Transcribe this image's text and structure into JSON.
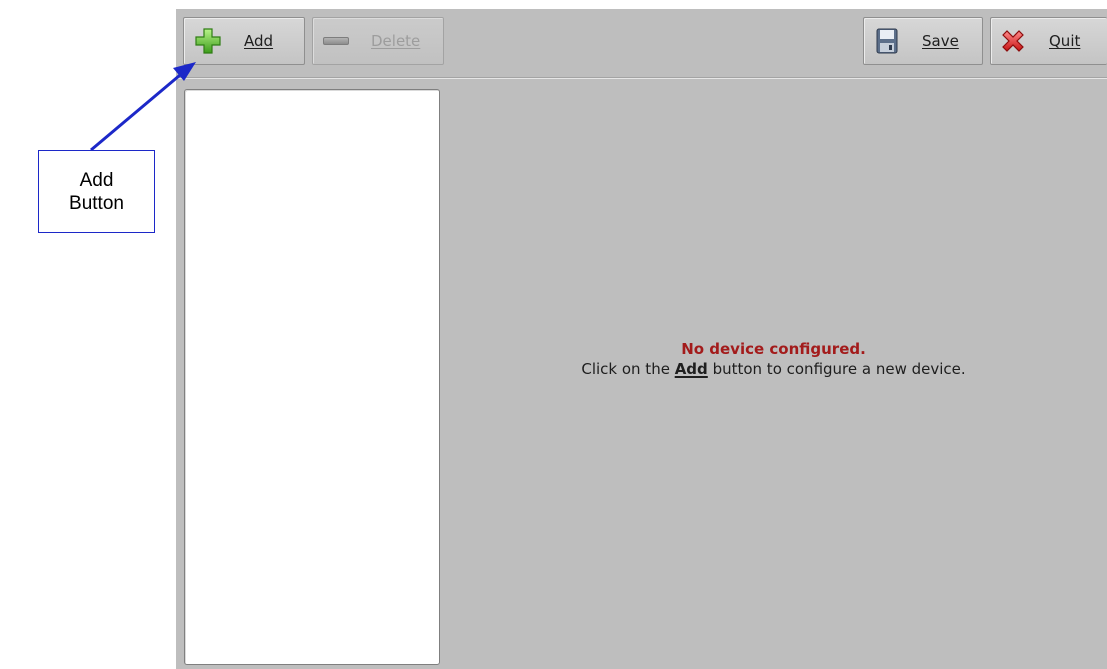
{
  "toolbar": {
    "add_label": "Add",
    "delete_label": "Delete",
    "save_label": "Save",
    "quit_label": "Quit"
  },
  "icons": {
    "add": "plus-icon",
    "delete": "minus-icon",
    "save": "floppy-disk-icon",
    "quit": "red-x-icon"
  },
  "main": {
    "status_title": "No device configured.",
    "hint_before": "Click on the ",
    "hint_keyword": "Add",
    "hint_after": " button to configure a new device."
  },
  "annotation": {
    "line1": "Add",
    "line2": "Button"
  },
  "colors": {
    "status_title": "#a31b1b",
    "annotation_border": "#1c28c8",
    "app_background": "#bebebe"
  }
}
